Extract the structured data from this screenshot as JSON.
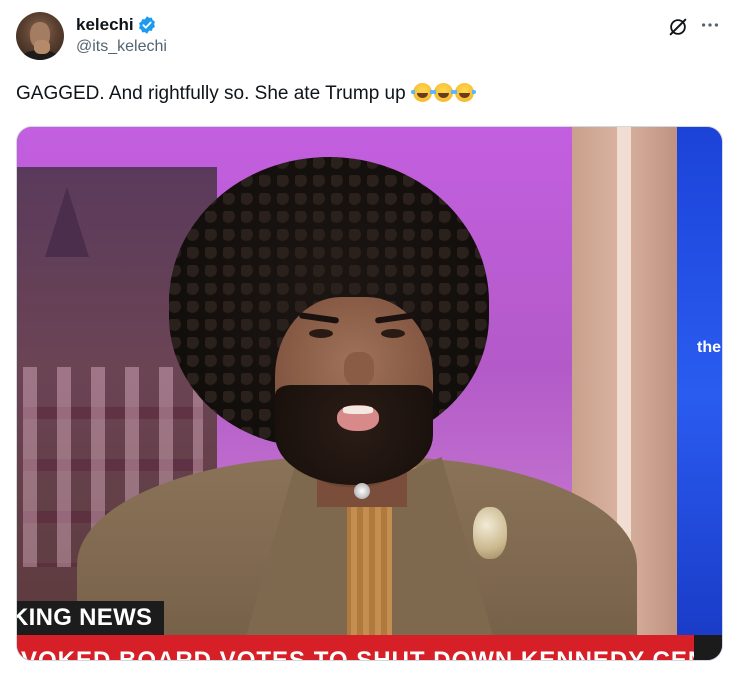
{
  "author": {
    "display_name": "kelechi",
    "handle": "@its_kelechi",
    "verified": true,
    "avatar": "avatar-photo"
  },
  "icons": {
    "verified": "verified-badge-icon",
    "grok": "grok-icon",
    "more": "more-options-icon"
  },
  "colors": {
    "verified_blue": "#1d9bf0",
    "text": "#0f1419",
    "secondary_text": "#536471",
    "ticker_red": "#d61f26"
  },
  "tweet": {
    "text": "GAGGED. And rightfully so. She ate Trump up",
    "emojis": [
      "😂",
      "😂",
      "😂"
    ]
  },
  "media": {
    "lower_third": "KING NEWS",
    "ticker": "VOKED BOARD VOTES TO SHUT DOWN KENNEDY CENTER",
    "screen_text": "the"
  }
}
